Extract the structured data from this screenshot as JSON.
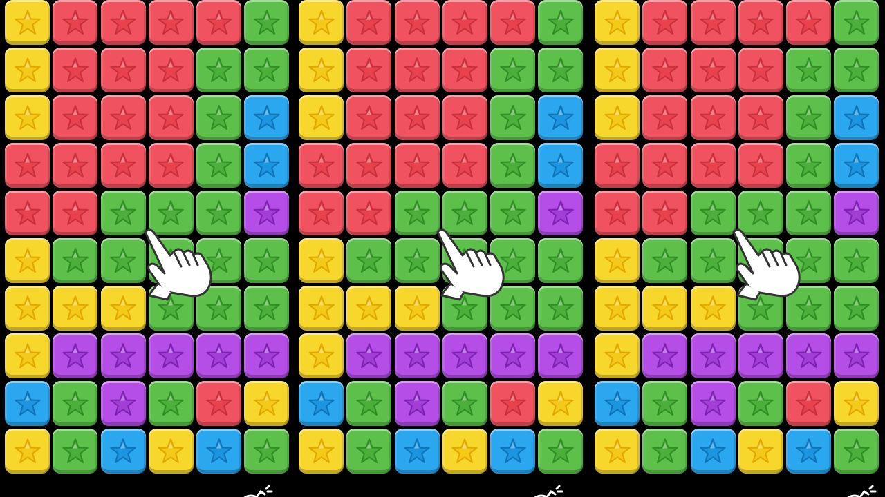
{
  "colors": {
    "yellow": {
      "fill": "#f7d72c",
      "star": "#f3c91a",
      "stroke": "#e0a800"
    },
    "red": {
      "fill": "#f0535f",
      "star": "#e8424f",
      "stroke": "#c7303c"
    },
    "green": {
      "fill": "#5cc04b",
      "star": "#4cae3b",
      "stroke": "#2f8f24"
    },
    "blue": {
      "fill": "#2aa7ee",
      "star": "#1c95e0",
      "stroke": "#0f73b8"
    },
    "purple": {
      "fill": "#b44ee6",
      "star": "#a23dd6",
      "stroke": "#7e22b0"
    }
  },
  "boards": [
    {
      "name": "board-left",
      "rows": [
        [
          "yellow",
          "red",
          "red",
          "red",
          "red",
          "green"
        ],
        [
          "yellow",
          "red",
          "red",
          "red",
          "green",
          "green"
        ],
        [
          "yellow",
          "red",
          "red",
          "red",
          "green",
          "blue"
        ],
        [
          "red",
          "red",
          "red",
          "red",
          "green",
          "blue"
        ],
        [
          "red",
          "red",
          "green",
          "green",
          "green",
          "purple"
        ],
        [
          "yellow",
          "green",
          "green",
          "green",
          "green",
          "green"
        ],
        [
          "yellow",
          "yellow",
          "yellow",
          "green",
          "green",
          "green"
        ],
        [
          "yellow",
          "purple",
          "purple",
          "purple",
          "purple",
          "purple"
        ],
        [
          "blue",
          "green",
          "purple",
          "green",
          "red",
          "yellow"
        ],
        [
          "yellow",
          "green",
          "blue",
          "yellow",
          "blue",
          "green"
        ]
      ]
    },
    {
      "name": "board-middle",
      "rows": [
        [
          "yellow",
          "red",
          "red",
          "red",
          "red",
          "green"
        ],
        [
          "yellow",
          "red",
          "red",
          "red",
          "green",
          "green"
        ],
        [
          "yellow",
          "red",
          "red",
          "red",
          "green",
          "blue"
        ],
        [
          "red",
          "red",
          "red",
          "red",
          "green",
          "blue"
        ],
        [
          "red",
          "red",
          "green",
          "green",
          "green",
          "purple"
        ],
        [
          "yellow",
          "green",
          "green",
          "green",
          "green",
          "green"
        ],
        [
          "yellow",
          "yellow",
          "yellow",
          "green",
          "green",
          "green"
        ],
        [
          "yellow",
          "purple",
          "purple",
          "purple",
          "purple",
          "purple"
        ],
        [
          "blue",
          "green",
          "purple",
          "green",
          "red",
          "yellow"
        ],
        [
          "yellow",
          "green",
          "blue",
          "yellow",
          "blue",
          "green"
        ]
      ]
    },
    {
      "name": "board-right",
      "rows": [
        [
          "yellow",
          "red",
          "red",
          "red",
          "red",
          "green"
        ],
        [
          "yellow",
          "red",
          "red",
          "red",
          "green",
          "green"
        ],
        [
          "yellow",
          "red",
          "red",
          "red",
          "green",
          "blue"
        ],
        [
          "red",
          "red",
          "red",
          "red",
          "green",
          "blue"
        ],
        [
          "red",
          "red",
          "green",
          "green",
          "green",
          "purple"
        ],
        [
          "yellow",
          "green",
          "green",
          "green",
          "green",
          "green"
        ],
        [
          "yellow",
          "yellow",
          "yellow",
          "green",
          "green",
          "green"
        ],
        [
          "yellow",
          "purple",
          "purple",
          "purple",
          "purple",
          "purple"
        ],
        [
          "blue",
          "green",
          "purple",
          "green",
          "red",
          "yellow"
        ],
        [
          "yellow",
          "green",
          "blue",
          "yellow",
          "blue",
          "green"
        ]
      ]
    }
  ],
  "icons": {
    "pointer": "pointing-hand-icon",
    "bomb": "bomb-icon",
    "tile": "star-icon"
  }
}
